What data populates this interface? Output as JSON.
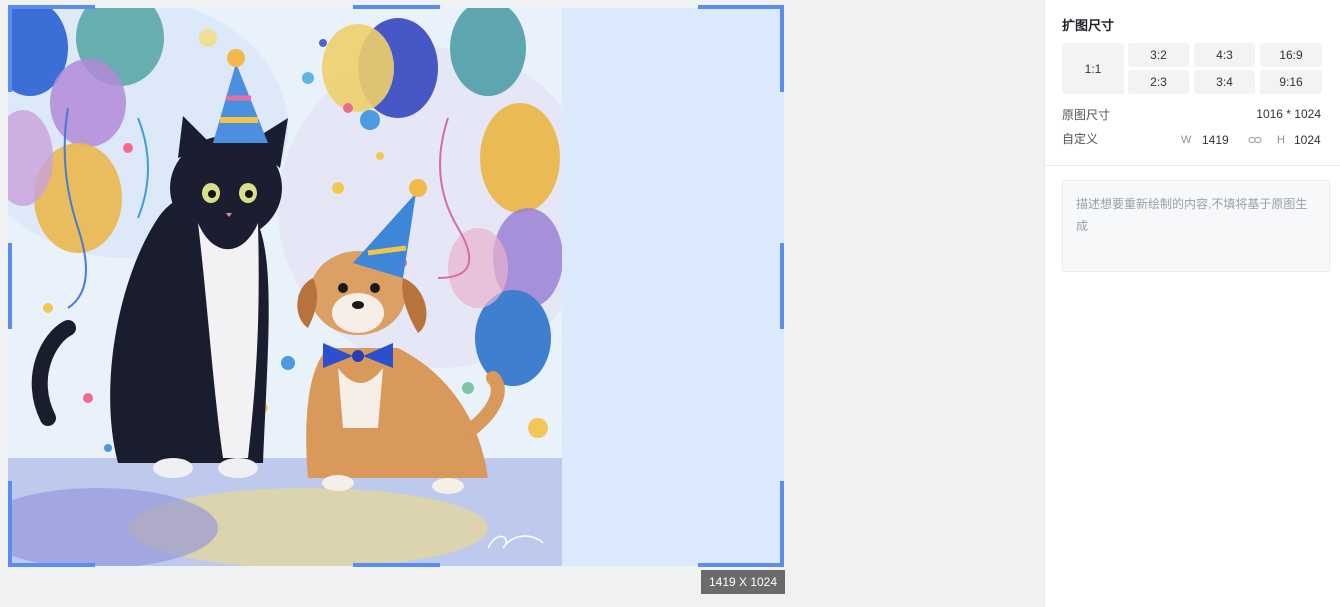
{
  "canvas": {
    "size_badge": "1419 X 1024",
    "colors": {
      "frame": "#dbe9fd",
      "handle": "#5b8def",
      "badge": "#6b6b6b"
    }
  },
  "panel": {
    "title": "扩图尺寸",
    "ratios": [
      "1:1",
      "3:2",
      "4:3",
      "16:9",
      "2:3",
      "3:4",
      "9:16"
    ],
    "original_size_label": "原图尺寸",
    "original_size_value": "1016 * 1024",
    "custom_label": "自定义",
    "width_label": "W",
    "width_value": "1419",
    "link_icon": "link-icon",
    "height_label": "H",
    "height_value": "1024",
    "prompt_placeholder": "描述想要重新绘制的内容,不填将基于原图生成"
  }
}
